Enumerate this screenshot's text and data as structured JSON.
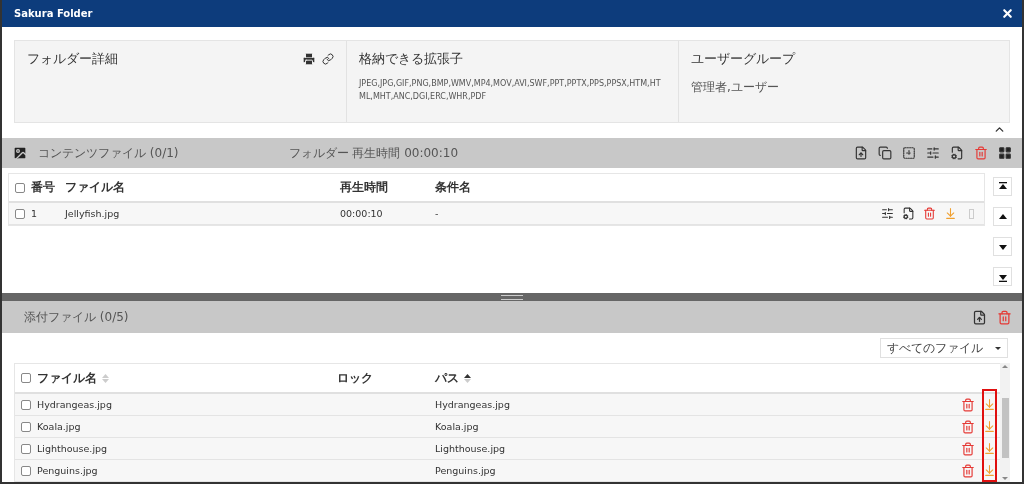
{
  "window": {
    "title": "Sakura Folder"
  },
  "details": [
    {
      "title": "フォルダー詳細"
    },
    {
      "title": "格納できる拡張子",
      "body": "JPEG,JPG,GIF,PNG,BMP,WMV,MP4,MOV,AVI,SWF,PPT,PPTX,PPS,PPSX,HTM,HTML,MHT,ANC,DGI,ERC,WHR,PDF"
    },
    {
      "title": "ユーザーグループ",
      "body": "管理者,ユーザー"
    }
  ],
  "content": {
    "title": "コンテンツファイル (0/1)",
    "duration": "フォルダー 再生時間 00:00:10",
    "all_checked": false,
    "columns": [
      "番号",
      "ファイル名",
      "再生時間",
      "条件名"
    ],
    "rows": [
      {
        "checked": false,
        "number": "1",
        "name": "Jellyfish.jpg",
        "duration": "00:00:10",
        "condition": "-"
      }
    ]
  },
  "attachments": {
    "title": "添付ファイル (0/5)",
    "filter": "すべてのファイル",
    "all_checked": false,
    "columns": [
      {
        "label": "ファイル名",
        "sorted": false
      },
      {
        "label": "ロック"
      },
      {
        "label": "パス",
        "sorted": true
      }
    ],
    "rows": [
      {
        "checked": false,
        "name": "Hydrangeas.jpg",
        "path": "Hydrangeas.jpg"
      },
      {
        "checked": false,
        "name": "Koala.jpg",
        "path": "Koala.jpg"
      },
      {
        "checked": false,
        "name": "Lighthouse.jpg",
        "path": "Lighthouse.jpg"
      },
      {
        "checked": false,
        "name": "Penguins.jpg",
        "path": "Penguins.jpg"
      }
    ]
  }
}
